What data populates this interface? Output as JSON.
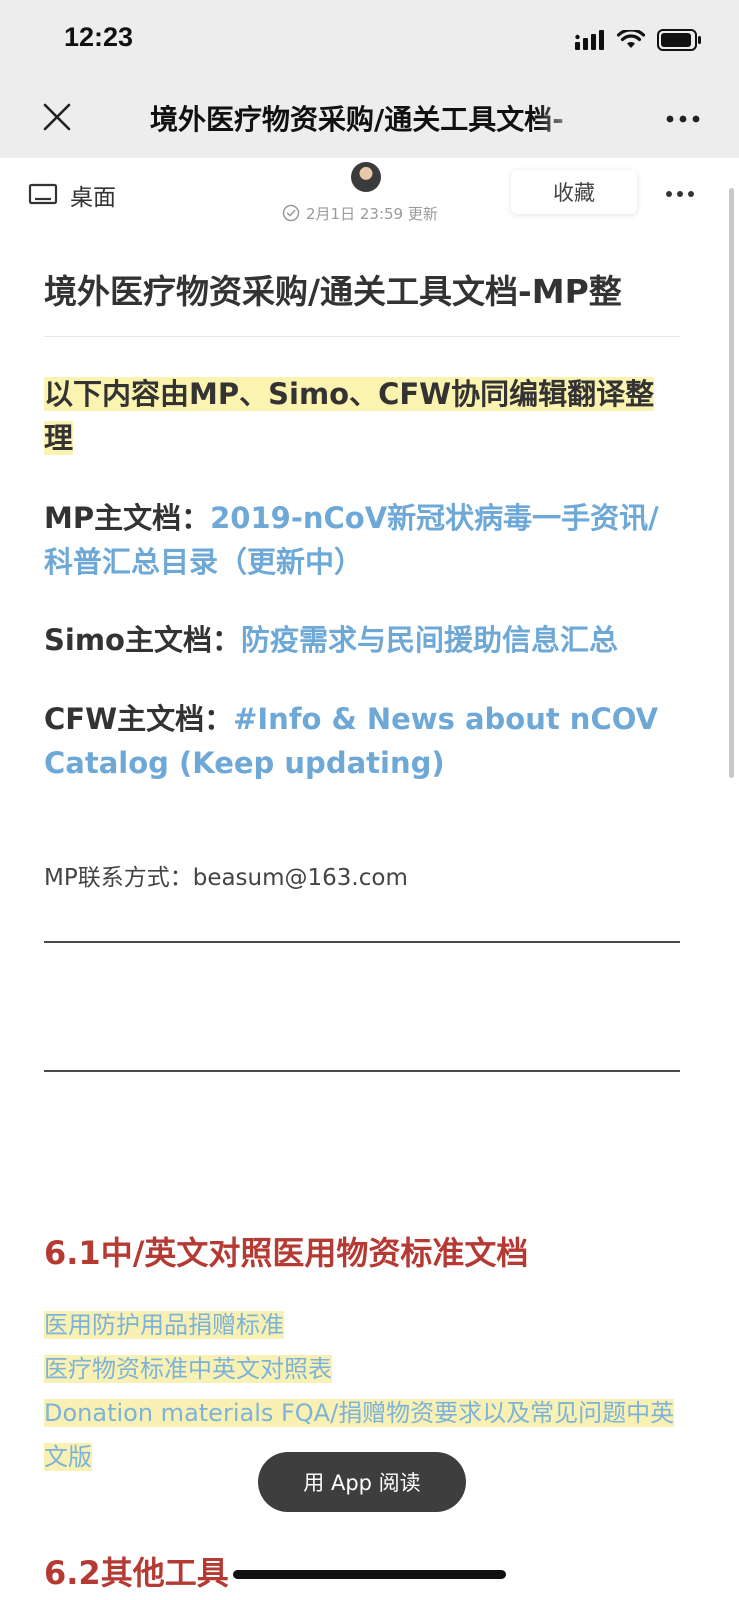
{
  "status_bar": {
    "time": "12:23"
  },
  "nav_bar": {
    "title": "境外医疗物资采购/通关工具文档-",
    "close_icon": "close-icon",
    "more_icon": "more-dots-icon"
  },
  "toolbar": {
    "desktop_label": "桌面",
    "update_time": "2月1日 23:59 更新",
    "favorite_label": "收藏"
  },
  "document": {
    "title": "境外医疗物资采购/通关工具文档-MP整",
    "intro": "以下内容由MP、Simo、CFW协同编辑翻译整理",
    "mp_main": {
      "prefix": "MP主文档：",
      "link": "2019-nCoV新冠状病毒一手资讯/科普汇总目录（更新中）"
    },
    "simo_main": {
      "prefix": "Simo主文档：",
      "link": "防疫需求与民间援助信息汇总"
    },
    "cfw_main": {
      "prefix": "CFW主文档：",
      "link": "#Info & News about nCOV Catalog (Keep updating)"
    },
    "contact": "MP联系方式：beasum@163.com",
    "section_6_1": {
      "heading": "6.1中/英文对照医用物资标准文档",
      "links": [
        "医用防护用品捐赠标准",
        "医疗物资标准中英文对照表",
        "Donation materials FQA/捐赠物资要求以及常见问题中英文版"
      ]
    },
    "next_heading": "6.2其他工具"
  },
  "floating": {
    "app_read_label": "用 App 阅读"
  },
  "colors": {
    "highlight": "#fbf3b0",
    "link": "#6ea8d7",
    "section_heading": "#b53a33",
    "bar_background": "#ededed"
  }
}
